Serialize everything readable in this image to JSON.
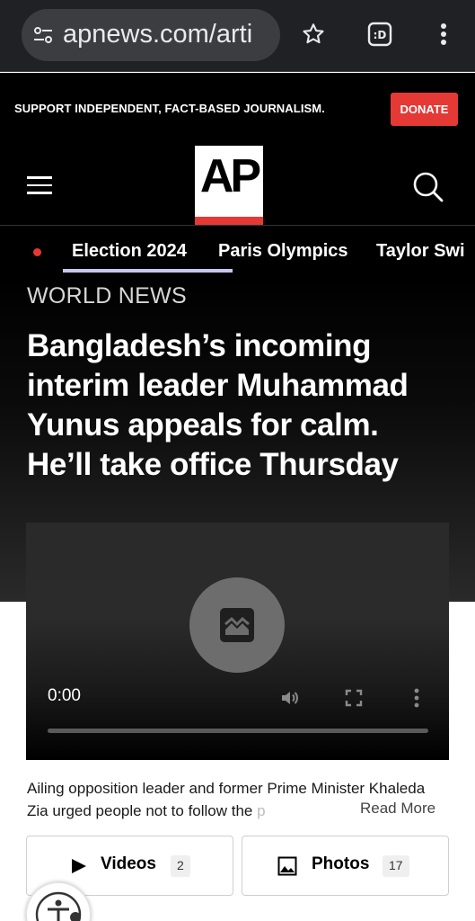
{
  "browser": {
    "url": "apnews.com/arti",
    "icons": [
      "tune-icon",
      "star-icon",
      "tab-switcher-icon",
      "more-vert-icon"
    ]
  },
  "site": {
    "support_text": "SUPPORT INDEPENDENT, FACT-BASED JOURNALISM.",
    "donate_label": "DONATE",
    "logo_text": "AP",
    "brand_red": "#e53935"
  },
  "nav": {
    "items": [
      {
        "label": "Election 2024",
        "active": true,
        "live": true
      },
      {
        "label": "Paris Olympics"
      },
      {
        "label": "Taylor Swi"
      }
    ]
  },
  "article": {
    "section": "WORLD NEWS",
    "headline": "Bangladesh’s incoming interim leader Muhammad Yunus appeals for calm. He’ll take office Thursday",
    "caption_main": "Ailing opposition leader and former Prime Minister Khaleda Zia urged people not to follow the ",
    "caption_fade": "p",
    "read_more": "Read More"
  },
  "video": {
    "time": "0:00",
    "progress": 0
  },
  "media": {
    "videos_label": "Videos",
    "videos_count": "2",
    "photos_label": "Photos",
    "photos_count": "17"
  }
}
